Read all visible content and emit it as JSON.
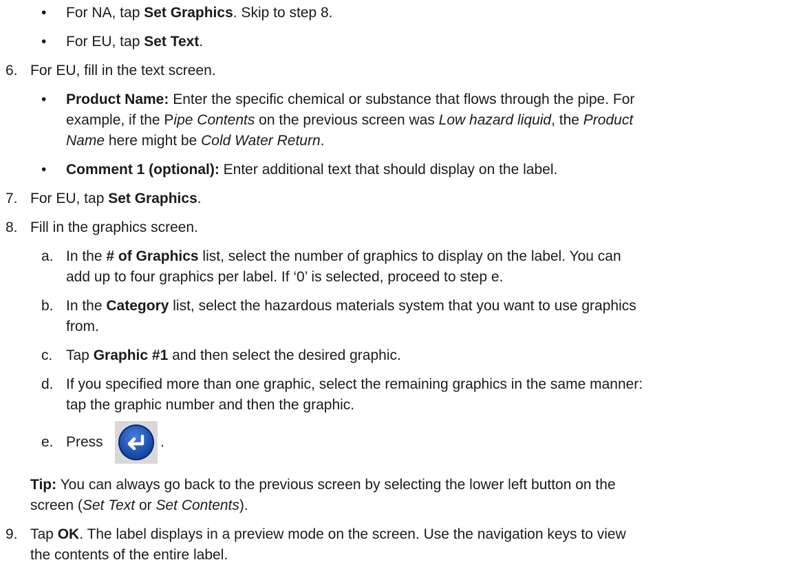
{
  "bullets_top": {
    "b1": {
      "pre": "For NA, tap ",
      "bold": "Set Graphics",
      "post": ". Skip to step 8."
    },
    "b2": {
      "pre": "For EU, tap ",
      "bold": "Set Text",
      "post": "."
    }
  },
  "step6": {
    "num": "6.",
    "text": "For EU, fill in the text screen.",
    "product": {
      "label": "Product Name:",
      "t1": " Enter the specific chemical or substance that flows through the pipe. For",
      "t2a": "example, if the P",
      "t2i": "ipe Contents",
      "t2b": " on the previous screen was ",
      "t2i2": "Low hazard liquid",
      "t2c": ", the ",
      "t2i3": "Product",
      "t3i": "Name",
      "t3a": " here might be ",
      "t3i2": "Cold Water Return",
      "t3b": "."
    },
    "comment": {
      "label": "Comment 1 (optional):",
      "text": " Enter additional text that should display on the label."
    }
  },
  "step7": {
    "num": "7.",
    "pre": "For EU, tap ",
    "bold": "Set Graphics",
    "post": "."
  },
  "step8": {
    "num": "8.",
    "text": "Fill in the graphics screen.",
    "a": {
      "letter": "a.",
      "pre": "In the ",
      "bold": "# of Graphics",
      "post": " list, select the number of graphics to display on the label. You can",
      "line2": "add up to four graphics per label. If ‘0’ is selected, proceed to step e."
    },
    "b": {
      "letter": "b.",
      "pre": "In the ",
      "bold": "Category",
      "post": " list, select the hazardous materials system that you want to use graphics",
      "line2": "from."
    },
    "c": {
      "letter": "c.",
      "pre": "Tap ",
      "bold": "Graphic #1",
      "post": " and then select the desired graphic."
    },
    "d": {
      "letter": "d.",
      "line1": "If you specified more than one graphic, select the remaining graphics in the same manner:",
      "line2": "tap the graphic number and then the graphic."
    },
    "e": {
      "letter": "e.",
      "pre": "Press",
      "post": ".",
      "icon": "enter-key-icon"
    }
  },
  "tip": {
    "label": "Tip:",
    "l1": " You can always go back to the previous screen by selecting the lower left button on the",
    "l2a": "screen (",
    "l2i": "Set Text",
    "l2b": " or ",
    "l2i2": "Set Contents",
    "l2c": ")."
  },
  "step9": {
    "num": "9.",
    "pre": "Tap ",
    "bold": "OK",
    "post": ". The label displays in a preview mode on the screen. Use the navigation keys to view",
    "line2": "the contents of the entire label."
  },
  "bullet_char": "•",
  "colors": {
    "enter_key_blue": "#1d4fb0",
    "enter_key_bg": "#d8d8d8"
  }
}
